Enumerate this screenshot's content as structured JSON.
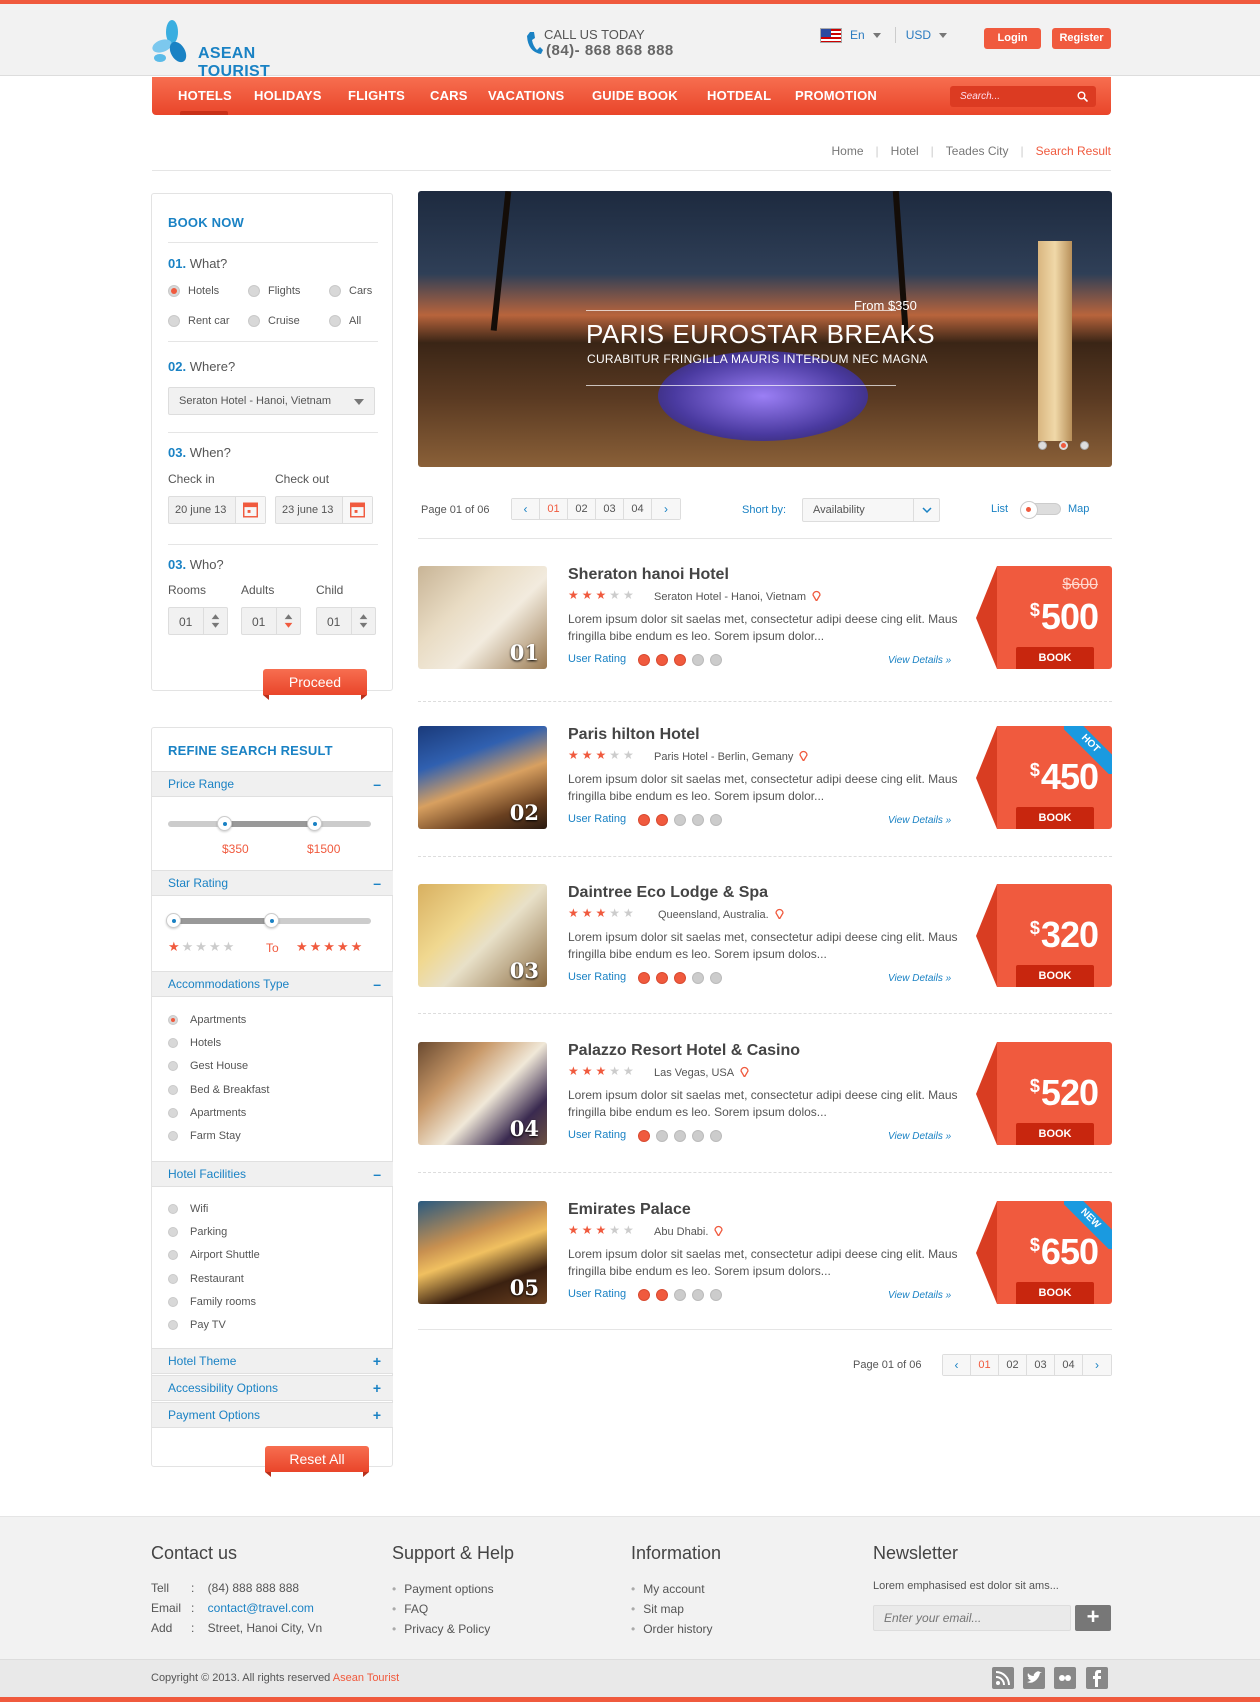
{
  "brand": {
    "name": "ASEAN TOURIST"
  },
  "header": {
    "call_label": "CALL US TODAY",
    "call_number": "(84)- 868 868 888",
    "language": "En",
    "currency": "USD",
    "login": "Login",
    "register": "Register"
  },
  "nav": {
    "items": [
      "HOTELS",
      "HOLIDAYS",
      "FLIGHTS",
      "CARS",
      "VACATIONS",
      "GUIDE BOOK",
      "HOTDEAL",
      "PROMOTION"
    ],
    "active": "HOTELS",
    "search_placeholder": "Search..."
  },
  "breadcrumb": [
    "Home",
    "Hotel",
    "Teades City",
    "Search Result"
  ],
  "book_now": {
    "title": "BOOK NOW",
    "step1": {
      "num": "01.",
      "label": "What?",
      "options": [
        "Hotels",
        "Flights",
        "Cars",
        "Rent car",
        "Cruise",
        "All"
      ],
      "selected": "Hotels"
    },
    "step2": {
      "num": "02.",
      "label": "Where?",
      "value": "Seraton Hotel - Hanoi, Vietnam"
    },
    "step3": {
      "num": "03.",
      "label": "When?",
      "checkin_label": "Check in",
      "checkin": "20 june 13",
      "checkout_label": "Check out",
      "checkout": "23 june 13"
    },
    "step4": {
      "num": "03.",
      "label": "Who?",
      "rooms_label": "Rooms",
      "rooms": "01",
      "adults_label": "Adults",
      "adults": "01",
      "child_label": "Child",
      "child": "01"
    },
    "proceed": "Proceed"
  },
  "refine": {
    "title": "REFINE SEARCH RESULT",
    "price_range": {
      "label": "Price Range",
      "toggle": "–",
      "min": "$350",
      "max": "$1500"
    },
    "star_rating": {
      "label": "Star Rating",
      "toggle": "–",
      "to": "To",
      "min_stars": 1,
      "max_stars": 5
    },
    "accommodation": {
      "label": "Accommodations Type",
      "toggle": "–",
      "options": [
        "Apartments",
        "Hotels",
        "Gest House",
        "Bed & Breakfast",
        "Apartments",
        "Farm Stay"
      ],
      "selected": 0
    },
    "facilities": {
      "label": "Hotel Facilities",
      "toggle": "–",
      "options": [
        "Wifi",
        "Parking",
        "Airport Shuttle",
        "Restaurant",
        "Family rooms",
        "Pay TV"
      ]
    },
    "collapsed": [
      {
        "label": "Hotel Theme",
        "toggle": "+"
      },
      {
        "label": "Accessibility Options",
        "toggle": "+"
      },
      {
        "label": "Payment Options",
        "toggle": "+"
      }
    ],
    "reset": "Reset All"
  },
  "hero": {
    "from": "From $350",
    "title": "PARIS EUROSTAR BREAKS",
    "subtitle": "CURABITUR FRINGILLA MAURIS INTERDUM NEC MAGNA",
    "slides": 3,
    "active_slide": 2
  },
  "toolbar": {
    "page_info": "Page 01 of 06",
    "pages": [
      "01",
      "02",
      "03",
      "04"
    ],
    "current_page": "01",
    "prev": "‹",
    "next": "›",
    "sort_label": "Short by:",
    "sort_value": "Availability",
    "view_list": "List",
    "view_map": "Map"
  },
  "hotels": [
    {
      "num": "01",
      "name": "Sheraton hanoi Hotel",
      "stars": 3,
      "location": "Seraton Hotel - Hanoi, Vietnam",
      "desc": "Lorem ipsum dolor sit saelas met, consectetur adipi deese cing elit. Maus fringilla bibe endum es leo. Sorem ipsum dolor...",
      "user_rating_label": "User Rating",
      "user_rating": 3,
      "view": "View Details »",
      "old_price": "$600",
      "currency": "$",
      "price": "500",
      "book": "BOOK",
      "badge": ""
    },
    {
      "num": "02",
      "name": "Paris hilton Hotel",
      "stars": 3,
      "location": "Paris Hotel - Berlin, Gemany",
      "desc": "Lorem ipsum dolor sit saelas met, consectetur adipi deese cing elit. Maus fringilla bibe endum es leo. Sorem ipsum dolor...",
      "user_rating_label": "User Rating",
      "user_rating": 2,
      "view": "View Details »",
      "old_price": "",
      "currency": "$",
      "price": "450",
      "book": "BOOK",
      "badge": "HOT"
    },
    {
      "num": "03",
      "name": "Daintree Eco Lodge & Spa",
      "stars": 3,
      "location": "Queensland, Australia.",
      "desc": "Lorem ipsum dolor sit saelas met, consectetur adipi deese cing elit. Maus fringilla bibe endum es leo. Sorem ipsum dolos...",
      "user_rating_label": "User Rating",
      "user_rating": 3,
      "view": "View Details »",
      "old_price": "",
      "currency": "$",
      "price": "320",
      "book": "BOOK",
      "badge": ""
    },
    {
      "num": "04",
      "name": "Palazzo Resort Hotel & Casino",
      "stars": 3,
      "location": "Las Vegas, USA",
      "desc": "Lorem ipsum dolor sit saelas met, consectetur adipi deese cing elit. Maus fringilla bibe endum es leo. Sorem ipsum dolos...",
      "user_rating_label": "User Rating",
      "user_rating": 1,
      "view": "View Details »",
      "old_price": "",
      "currency": "$",
      "price": "520",
      "book": "BOOK",
      "badge": ""
    },
    {
      "num": "05",
      "name": "Emirates Palace",
      "stars": 3,
      "location": "Abu Dhabi.",
      "desc": "Lorem ipsum dolor sit saelas met, consectetur adipi deese cing elit. Maus fringilla bibe endum es leo. Sorem ipsum dolors...",
      "user_rating_label": "User Rating",
      "user_rating": 2,
      "view": "View Details »",
      "old_price": "",
      "currency": "$",
      "price": "650",
      "book": "BOOK",
      "badge": "NEW"
    }
  ],
  "footer": {
    "contact": {
      "title": "Contact us",
      "tell_label": "Tell",
      "tell": "(84) 888 888 888",
      "email_label": "Email",
      "email": "contact@travel.com",
      "add_label": "Add",
      "add": "Street, Hanoi City, Vn"
    },
    "support": {
      "title": "Support & Help",
      "items": [
        "Payment options",
        "FAQ",
        "Privacy & Policy"
      ]
    },
    "information": {
      "title": "Information",
      "items": [
        "My account",
        "Sit map",
        "Order history"
      ]
    },
    "newsletter": {
      "title": "Newsletter",
      "text": "Lorem emphasised est dolor sit ams...",
      "placeholder": "Enter your email...",
      "button": "+"
    },
    "copyright": "Copyright © 2013. All rights reserved",
    "copyright_brand": "Asean Tourist"
  },
  "colors": {
    "accent": "#f05a3e",
    "link": "#1a82c4"
  }
}
